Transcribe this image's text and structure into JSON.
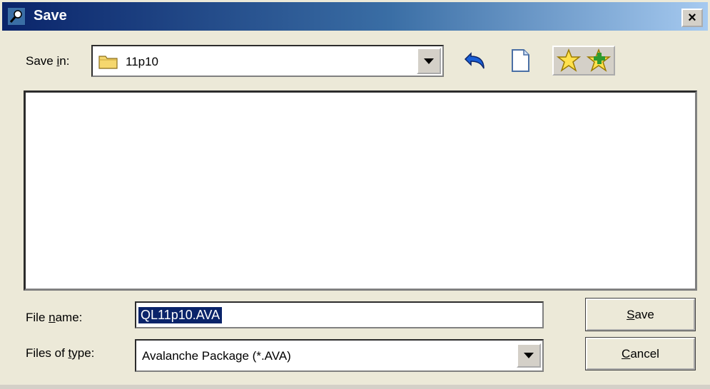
{
  "window": {
    "title": "Save",
    "close_label": "×"
  },
  "toolbar": {
    "save_in_label_pre": "Save ",
    "save_in_label_key": "i",
    "save_in_label_post": "n:",
    "save_in_value": "11p10",
    "icons": [
      "folder-icon",
      "back-icon",
      "new-folder-icon",
      "favorites-icon",
      "add-favorite-icon"
    ]
  },
  "file_list": {
    "items": []
  },
  "form": {
    "file_name_label_pre": "File ",
    "file_name_label_key": "n",
    "file_name_label_post": "ame:",
    "file_name_value": "QL11p10.AVA",
    "file_type_label_pre": "Files of ",
    "file_type_label_key": "t",
    "file_type_label_post": "ype:",
    "file_type_value": "Avalanche Package (*.AVA)"
  },
  "buttons": {
    "save_key": "S",
    "save_rest": "ave",
    "cancel_key": "C",
    "cancel_rest": "ancel"
  },
  "colors": {
    "titlebar_start": "#0a246a",
    "titlebar_end": "#a6caf0",
    "dialog_bg": "#ece9d8",
    "selection": "#0a246a"
  }
}
